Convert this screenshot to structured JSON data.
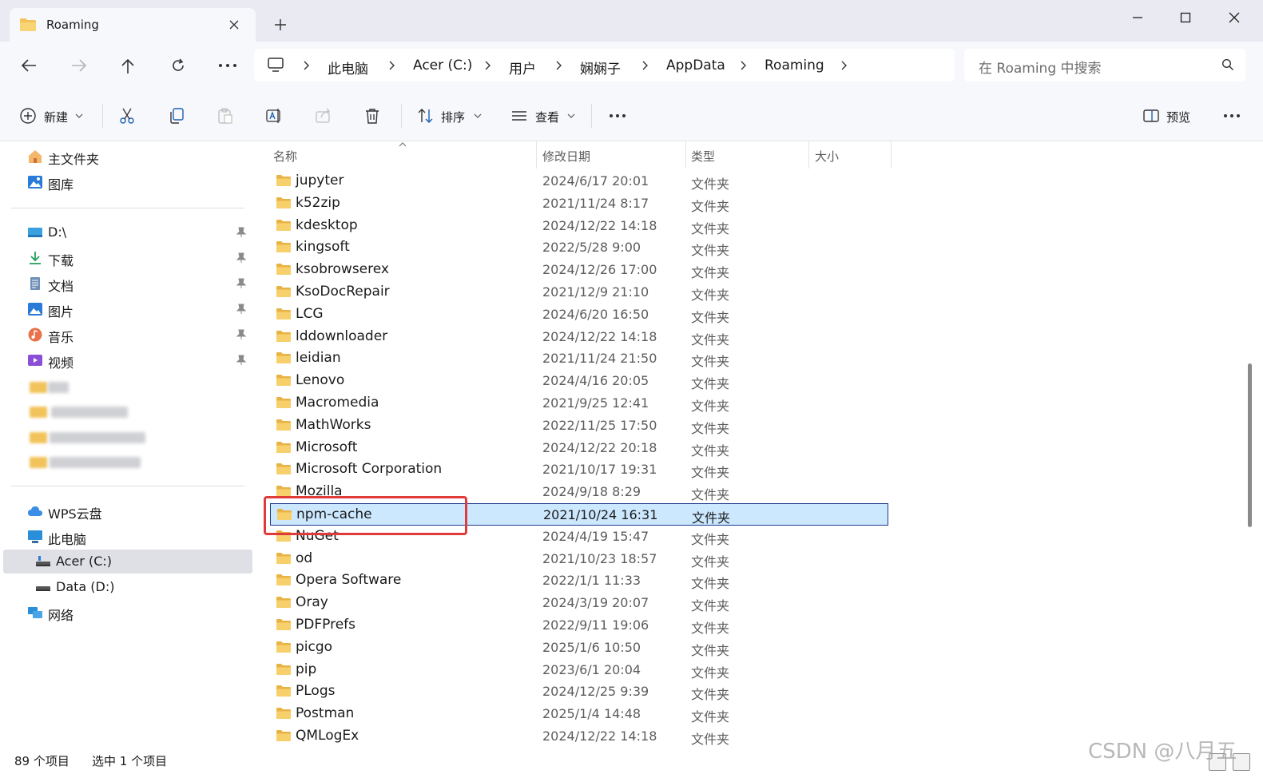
{
  "window": {
    "tab_title": "Roaming",
    "new_tab_symbol": "+"
  },
  "nav": {
    "breadcrumbs": [
      "此电脑",
      "Acer (C:)",
      "用户",
      "娴娴子",
      "AppData",
      "Roaming"
    ],
    "search_placeholder": "在 Roaming 中搜索"
  },
  "commands": {
    "new_label": "新建",
    "sort_label": "排序",
    "view_label": "查看",
    "preview_label": "预览",
    "more_symbol": "•••"
  },
  "sidebar": {
    "quick": [
      {
        "label": "主文件夹",
        "icon": "home-icon"
      },
      {
        "label": "图库",
        "icon": "gallery-icon"
      }
    ],
    "pinned": [
      {
        "label": "D:\\",
        "icon": "drive-icon"
      },
      {
        "label": "下载",
        "icon": "download-icon"
      },
      {
        "label": "文档",
        "icon": "document-icon"
      },
      {
        "label": "图片",
        "icon": "pictures-icon"
      },
      {
        "label": "音乐",
        "icon": "music-icon"
      },
      {
        "label": "视频",
        "icon": "video-icon"
      }
    ],
    "locations": [
      {
        "label": "WPS云盘",
        "icon": "cloud-icon"
      },
      {
        "label": "此电脑",
        "icon": "computer-icon"
      },
      {
        "label": "Acer (C:)",
        "icon": "drive-c-icon"
      },
      {
        "label": "Data (D:)",
        "icon": "drive-d-icon"
      },
      {
        "label": "网络",
        "icon": "network-icon"
      }
    ]
  },
  "list": {
    "columns": {
      "name": "名称",
      "date": "修改日期",
      "type": "类型",
      "size": "大小"
    },
    "rows": [
      {
        "name": "jupyter",
        "date": "2024/6/17 20:01",
        "type": "文件夹"
      },
      {
        "name": "k52zip",
        "date": "2021/11/24 8:17",
        "type": "文件夹"
      },
      {
        "name": "kdesktop",
        "date": "2024/12/22 14:18",
        "type": "文件夹"
      },
      {
        "name": "kingsoft",
        "date": "2022/5/28 9:00",
        "type": "文件夹"
      },
      {
        "name": "ksobrowserex",
        "date": "2024/12/26 17:00",
        "type": "文件夹"
      },
      {
        "name": "KsoDocRepair",
        "date": "2021/12/9 21:10",
        "type": "文件夹"
      },
      {
        "name": "LCG",
        "date": "2024/6/20 16:50",
        "type": "文件夹"
      },
      {
        "name": "lddownloader",
        "date": "2024/12/22 14:18",
        "type": "文件夹"
      },
      {
        "name": "leidian",
        "date": "2021/11/24 21:50",
        "type": "文件夹"
      },
      {
        "name": "Lenovo",
        "date": "2024/4/16 20:05",
        "type": "文件夹"
      },
      {
        "name": "Macromedia",
        "date": "2021/9/25 12:41",
        "type": "文件夹"
      },
      {
        "name": "MathWorks",
        "date": "2022/11/25 17:50",
        "type": "文件夹"
      },
      {
        "name": "Microsoft",
        "date": "2024/12/22 20:18",
        "type": "文件夹"
      },
      {
        "name": "Microsoft Corporation",
        "date": "2021/10/17 19:31",
        "type": "文件夹"
      },
      {
        "name": "Mozilla",
        "date": "2024/9/18 8:29",
        "type": "文件夹"
      },
      {
        "name": "npm-cache",
        "date": "2021/10/24 16:31",
        "type": "文件夹",
        "selected": true
      },
      {
        "name": "NuGet",
        "date": "2024/4/19 15:47",
        "type": "文件夹"
      },
      {
        "name": "od",
        "date": "2021/10/23 18:57",
        "type": "文件夹"
      },
      {
        "name": "Opera Software",
        "date": "2022/1/1 11:33",
        "type": "文件夹"
      },
      {
        "name": "Oray",
        "date": "2024/3/19 20:07",
        "type": "文件夹"
      },
      {
        "name": "PDFPrefs",
        "date": "2022/9/11 19:06",
        "type": "文件夹"
      },
      {
        "name": "picgo",
        "date": "2025/1/6 10:50",
        "type": "文件夹"
      },
      {
        "name": "pip",
        "date": "2023/6/1 20:04",
        "type": "文件夹"
      },
      {
        "name": "PLogs",
        "date": "2024/12/25 9:39",
        "type": "文件夹"
      },
      {
        "name": "Postman",
        "date": "2025/1/4 14:48",
        "type": "文件夹"
      },
      {
        "name": "QMLogEx",
        "date": "2024/12/22 14:18",
        "type": "文件夹"
      }
    ]
  },
  "status": {
    "item_count": "89 个项目",
    "selected_count": "选中 1 个项目"
  },
  "watermark": "CSDN @八月五",
  "colors": {
    "accent": "#0067c0",
    "selection_bg": "#cce8ff",
    "highlight_box": "#e03b3b",
    "folder_yellow": "#f2c35a"
  }
}
